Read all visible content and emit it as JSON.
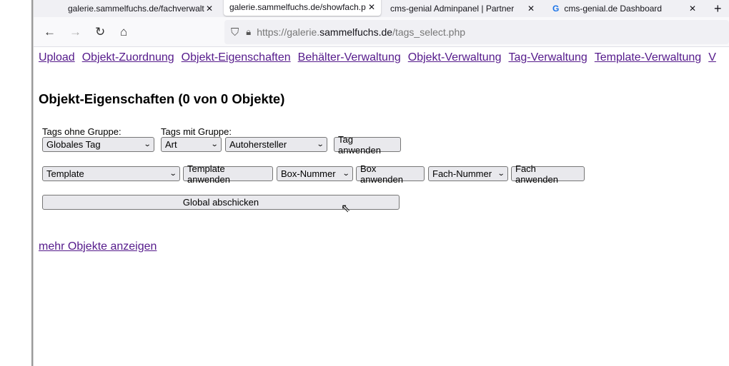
{
  "browser": {
    "tabs": [
      {
        "title": "galerie.sammelfuchs.de/fachverwalt",
        "active": false
      },
      {
        "title": "galerie.sammelfuchs.de/showfach.p",
        "active": true
      },
      {
        "title": "cms-genial Adminpanel | Partner",
        "active": false
      },
      {
        "title": "cms-genial.de Dashboard",
        "active": false
      }
    ],
    "close_glyph": "✕",
    "new_tab_glyph": "+",
    "url_prefix": "https://galerie.",
    "url_domain": "sammelfuchs.de",
    "url_path": "/tags_select.php"
  },
  "nav_links": [
    "Upload",
    "Objekt-Zuordnung",
    "Objekt-Eigenschaften",
    "Behälter-Verwaltung",
    "Objekt-Verwaltung",
    "Tag-Verwaltung",
    "Template-Verwaltung",
    "V"
  ],
  "page_title": "Objekt-Eigenschaften (0 von 0 Objekte)",
  "form": {
    "label_no_group": "Tags ohne Gruppe:",
    "label_with_group": "Tags mit Gruppe:",
    "select_global_tag": "Globales Tag",
    "select_group": "Art",
    "select_group_tag": "Autohersteller",
    "btn_tag": "Tag anwenden",
    "select_template": "Template",
    "btn_template": "Template anwenden",
    "select_box": "Box-Nummer",
    "btn_box": "Box anwenden",
    "select_fach": "Fach-Nummer",
    "btn_fach": "Fach anwenden",
    "btn_global": "Global abschicken"
  },
  "more_link": "mehr Objekte anzeigen"
}
